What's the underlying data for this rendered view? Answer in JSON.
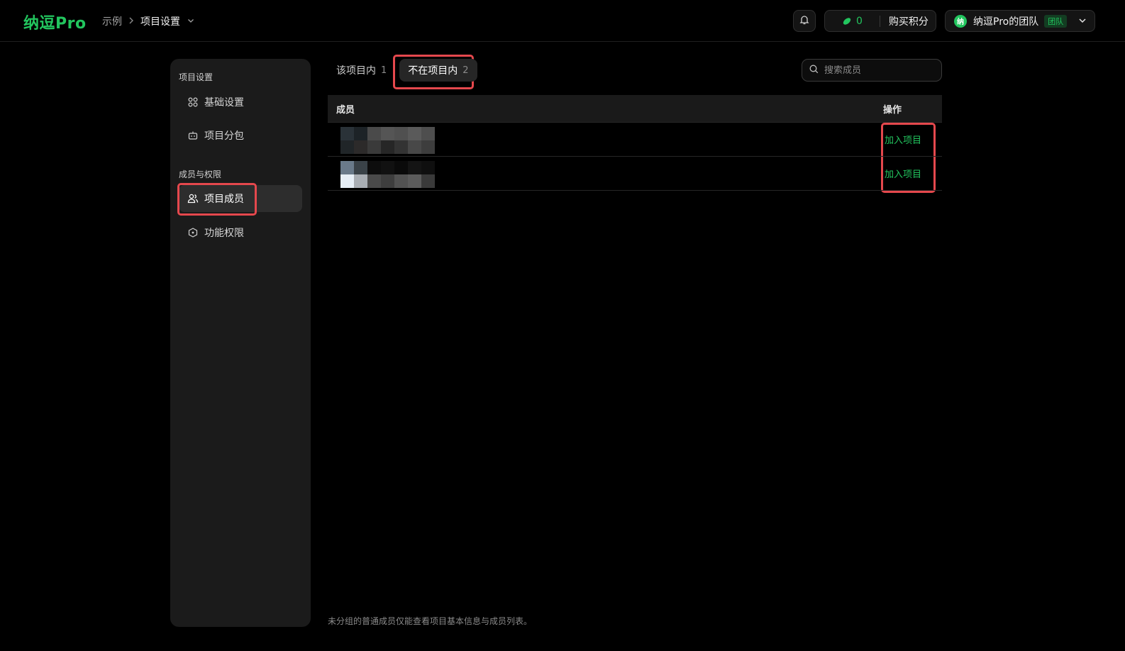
{
  "app": {
    "logo": "纳逗Pro"
  },
  "breadcrumb": {
    "parent": "示例",
    "current": "项目设置"
  },
  "header": {
    "credits_count": "0",
    "buy_label": "购买积分",
    "team_avatar": "纳",
    "team_name": "纳逗Pro的团队",
    "team_badge": "团队"
  },
  "sidebar": {
    "group1": "项目设置",
    "group2": "成员与权限",
    "items": [
      {
        "label": "基础设置",
        "icon": "grid-icon"
      },
      {
        "label": "项目分包",
        "icon": "bot-icon"
      },
      {
        "label": "项目成员",
        "icon": "users-icon"
      },
      {
        "label": "功能权限",
        "icon": "hexagon-icon"
      }
    ]
  },
  "tabs": [
    {
      "label": "该项目内",
      "count": "1"
    },
    {
      "label": "不在项目内",
      "count": "2"
    }
  ],
  "search": {
    "placeholder": "搜索成员"
  },
  "table": {
    "col_member": "成员",
    "col_action": "操作",
    "rows": [
      {
        "action": "加入项目"
      },
      {
        "action": "加入项目"
      }
    ]
  },
  "footnote": "未分组的普通成员仅能查看项目基本信息与成员列表。",
  "colors": {
    "accent": "#22c55e",
    "highlight": "#e5484d",
    "background": "#000000",
    "sidebar": "#1b1b1b"
  }
}
